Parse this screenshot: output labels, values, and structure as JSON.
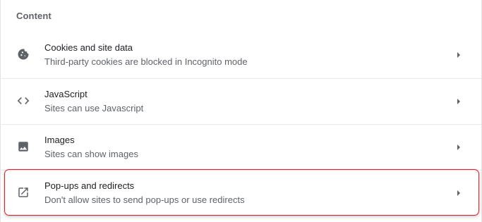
{
  "section": {
    "title": "Content"
  },
  "items": [
    {
      "icon": "cookie-icon",
      "label": "Cookies and site data",
      "sublabel": "Third-party cookies are blocked in Incognito mode"
    },
    {
      "icon": "code-icon",
      "label": "JavaScript",
      "sublabel": "Sites can use Javascript"
    },
    {
      "icon": "image-icon",
      "label": "Images",
      "sublabel": "Sites can show images"
    },
    {
      "icon": "open-in-new-icon",
      "label": "Pop-ups and redirects",
      "sublabel": "Don't allow sites to send pop-ups or use redirects"
    }
  ],
  "colors": {
    "highlight": "#e0202a",
    "icon": "#5f6368",
    "text_primary": "#202124",
    "text_secondary": "#5f6368"
  }
}
